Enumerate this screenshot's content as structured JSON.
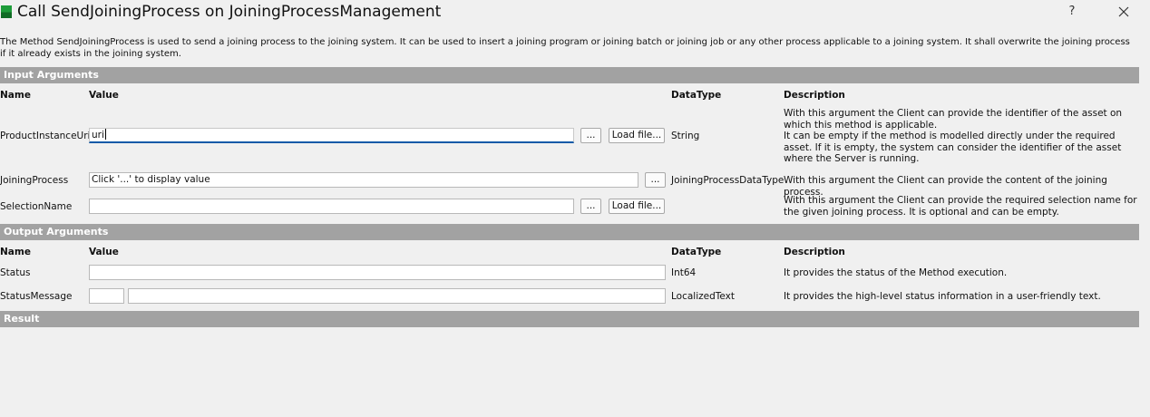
{
  "window": {
    "title": "Call SendJoiningProcess on JoiningProcessManagement",
    "help_label": "?"
  },
  "intro_text": "The Method SendJoiningProcess is used to send a joining process to the joining system. It can be used to insert a joining program or joining batch or joining job or any other process applicable to a joining system. It shall overwrite the joining process if it already exists in the joining system.",
  "input_section": {
    "title": "Input Arguments",
    "headers": {
      "name": "Name",
      "value": "Value",
      "datatype": "DataType",
      "description": "Description"
    },
    "rows": [
      {
        "name": "ProductInstanceUri",
        "value": "uri",
        "browse_label": "...",
        "load_label": "Load file...",
        "datatype": "String",
        "description": "With this argument the Client can provide the identifier of the asset on which this method is applicable.\nIt can be empty if the method is modelled directly under the required asset. If it is empty, the system can consider the identifier of the asset where the Server is running."
      },
      {
        "name": "JoiningProcess",
        "value": "Click '...' to display value",
        "browse_label": "...",
        "datatype": "JoiningProcessDataType",
        "description": "With this argument the Client can provide the content of the joining process."
      },
      {
        "name": "SelectionName",
        "value": "",
        "browse_label": "...",
        "load_label": "Load file...",
        "datatype": "",
        "description": "With this argument the Client can provide the required selection name for the given joining process. It is optional and can be empty."
      }
    ]
  },
  "output_section": {
    "title": "Output Arguments",
    "headers": {
      "name": "Name",
      "value": "Value",
      "datatype": "DataType",
      "description": "Description"
    },
    "rows": [
      {
        "name": "Status",
        "value": "",
        "datatype": "Int64",
        "description": "It provides the status of the Method execution."
      },
      {
        "name": "StatusMessage",
        "locale": "",
        "value": "",
        "datatype": "LocalizedText",
        "description": "It provides the high-level status information in a user-friendly text."
      }
    ]
  },
  "result_section": {
    "title": "Result"
  },
  "colors": {
    "section_bar": "#a2a2a2",
    "focus_underline": "#0f5aa8",
    "app_icon": "#1e9c3a"
  },
  "icons": {
    "app": "app-icon",
    "close": "close-icon"
  }
}
